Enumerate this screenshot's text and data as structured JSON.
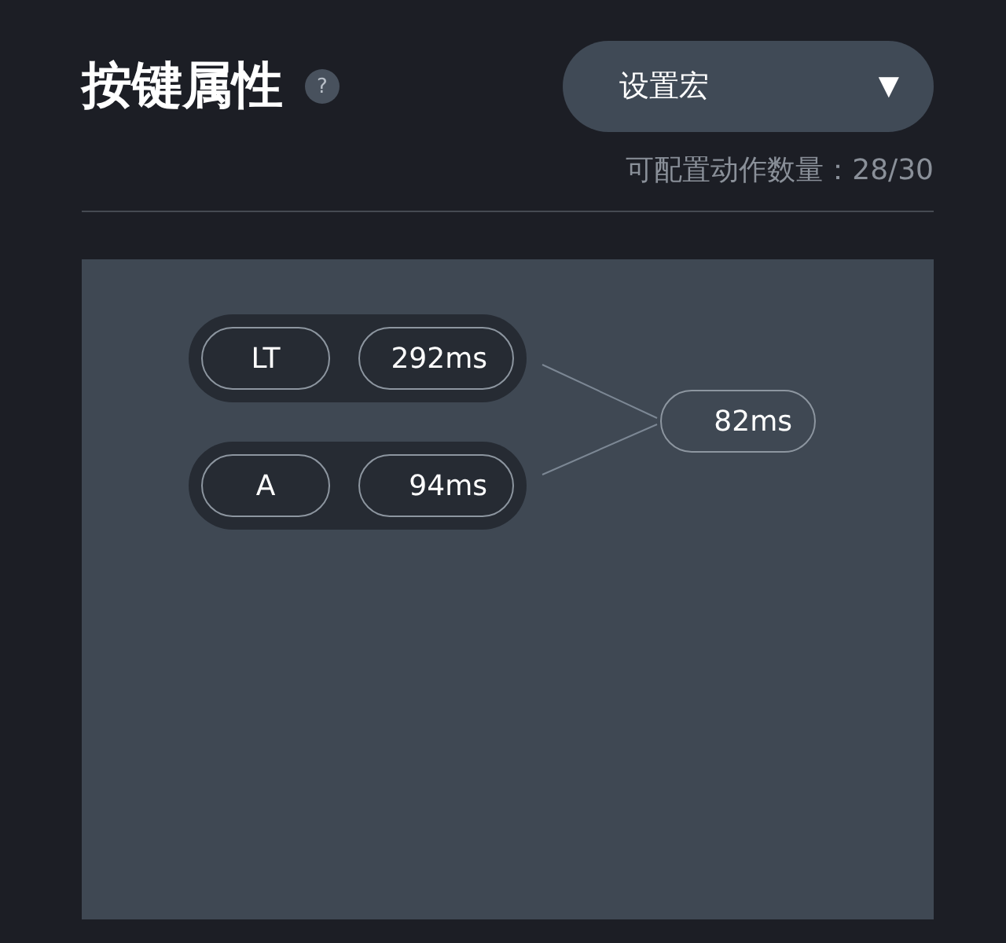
{
  "header": {
    "title": "按键属性",
    "help": "?"
  },
  "mode_dropdown": {
    "value": "设置宏",
    "caret": "▼"
  },
  "capacity": "可配置动作数量：28/30",
  "macro": {
    "actions": [
      {
        "key": "LT",
        "duration": "292ms"
      },
      {
        "key": "A",
        "duration": "94ms"
      }
    ],
    "interval": "82ms"
  }
}
